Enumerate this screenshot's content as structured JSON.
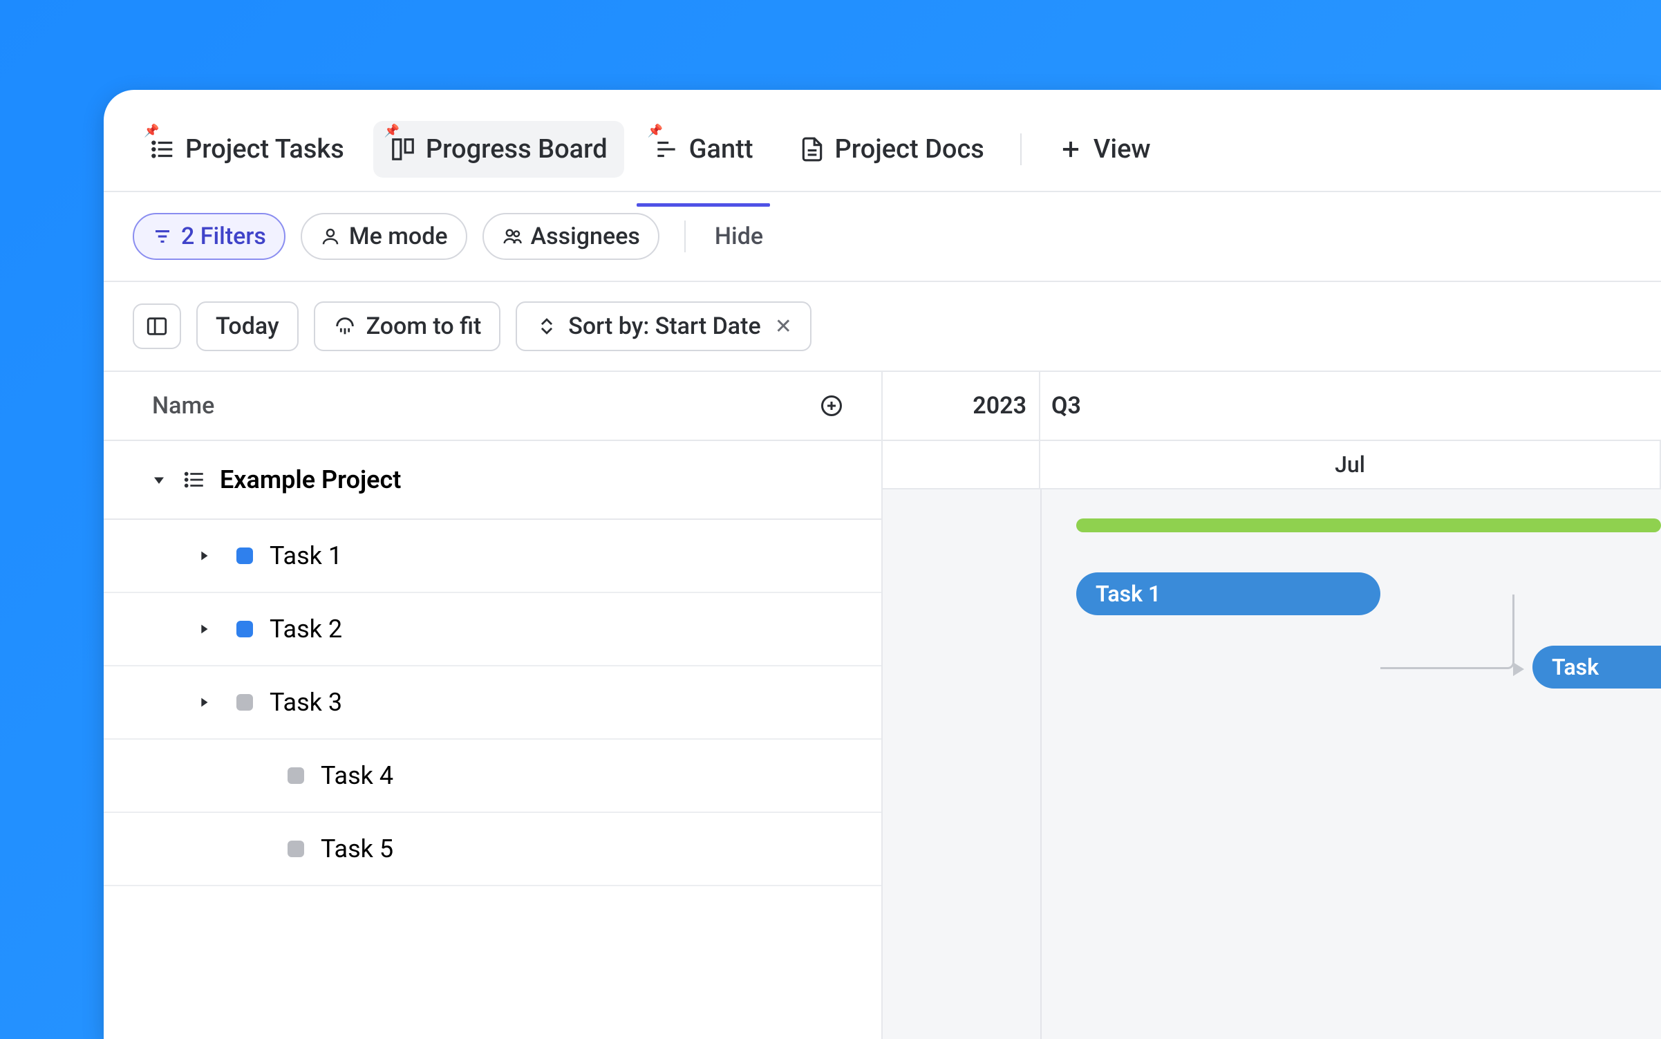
{
  "tabs": [
    {
      "label": "Project Tasks",
      "pinned": true
    },
    {
      "label": "Progress Board",
      "pinned": true
    },
    {
      "label": "Gantt",
      "pinned": true
    },
    {
      "label": "Project Docs",
      "pinned": false
    }
  ],
  "add_view_label": "View",
  "filters": {
    "filter_chip": "2 Filters",
    "me_mode": "Me mode",
    "assignees": "Assignees",
    "hide": "Hide"
  },
  "toolbar": {
    "today": "Today",
    "zoom_to_fit": "Zoom to fit",
    "sort_by_label": "Sort by: Start Date"
  },
  "list_header": "Name",
  "project": {
    "name": "Example Project"
  },
  "tasks": [
    {
      "name": "Task 1",
      "status": "blue",
      "expandable": true
    },
    {
      "name": "Task 2",
      "status": "blue",
      "expandable": true
    },
    {
      "name": "Task 3",
      "status": "gray",
      "expandable": true
    },
    {
      "name": "Task 4",
      "status": "gray",
      "expandable": false
    },
    {
      "name": "Task 5",
      "status": "gray",
      "expandable": false
    }
  ],
  "timeline": {
    "year": "2023",
    "quarter": "Q3",
    "month": "Jul"
  },
  "gantt_bars": {
    "task1": "Task 1",
    "task2_partial": "Task"
  }
}
